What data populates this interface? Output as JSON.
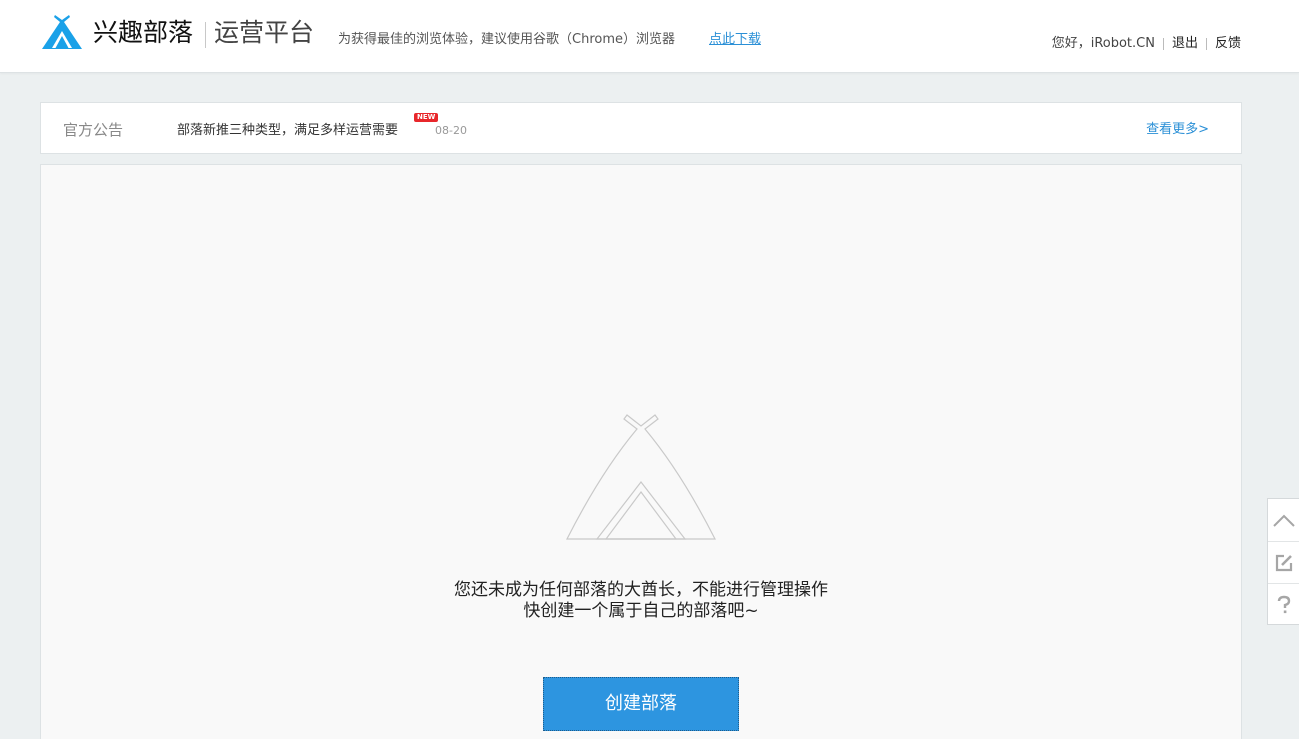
{
  "header": {
    "brand": "兴趣部落",
    "platform": "运营平台",
    "browser_tip": "为获得最佳的浏览体验，建议使用谷歌（Chrome）浏览器",
    "download_link": "点此下载",
    "greeting": "您好，iRobot.CN",
    "logout": "退出",
    "feedback": "反馈",
    "brand_color": "#1aa1e8"
  },
  "notice": {
    "label": "官方公告",
    "title": "部落新推三种类型，满足多样运营需要",
    "badge": "NEW",
    "date": "08-20",
    "more": "查看更多>"
  },
  "main": {
    "empty_line1": "您还未成为任何部落的大酋长，不能进行管理操作",
    "empty_line2": "快创建一个属于自己的部落吧~",
    "create_button": "创建部落",
    "button_color": "#2d95e0"
  },
  "float_tools": {
    "items": [
      {
        "icon": "chevron-up-icon"
      },
      {
        "icon": "edit-icon"
      },
      {
        "icon": "question-icon"
      }
    ]
  }
}
